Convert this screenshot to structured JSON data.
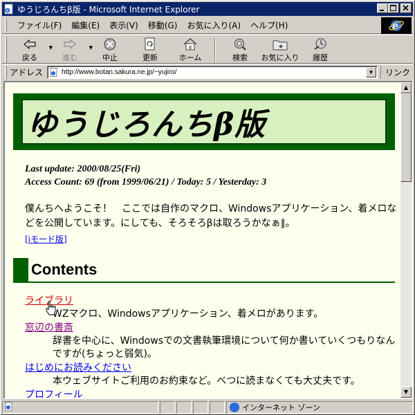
{
  "window": {
    "title": "ゆうじろんちβ版 - Microsoft Internet Explorer",
    "buttons": [
      "minimize",
      "maximize",
      "close"
    ]
  },
  "menu": {
    "items": [
      "ファイル(F)",
      "編集(E)",
      "表示(V)",
      "移動(G)",
      "お気に入り(A)",
      "ヘルプ(H)"
    ]
  },
  "toolbar": {
    "back": "戻る",
    "forward": "進む",
    "stop": "中止",
    "refresh": "更新",
    "home": "ホーム",
    "search": "検索",
    "favorites": "お気に入り",
    "history": "履歴"
  },
  "address": {
    "label": "アドレス",
    "url": "http://www.botan.sakura.ne.jp/~yujiro/",
    "links": "リンク"
  },
  "page": {
    "banner_title": "ゆうじろんちβ版",
    "last_update": "Last update: 2000/08/25(Fri)",
    "access_count": "Access Count: 69 (from 1999/06/21) / Today: 5 / Yesterday: 3",
    "intro": "僕んちへようこそ！　ここでは自作のマクロ、Windowsアプリケーション、着メロなどを公開しています。にしても、そろそろβは取ろうかなぁ∥。",
    "imode_link": "[iモード版]",
    "contents_heading": "Contents",
    "entries": [
      {
        "link": "ライブラリ",
        "desc": "WZマクロ、Windowsアプリケーション、着メロがあります。"
      },
      {
        "link": "窓辺の書斎",
        "desc": "辞書を中心に、Windowsでの文書執筆環境について何か書いていくつもりなんですが(ちょっと弱気)。"
      },
      {
        "link": "はじめにお読みください",
        "desc": "本ウェブサイトご利用のお約束など。べつに読まなくても大丈夫です。"
      },
      {
        "link": "プロフィール",
        "desc": ""
      }
    ]
  },
  "status": {
    "main": "",
    "zone": "インターネット ゾーン"
  },
  "colors": {
    "title_bar": "#0a246a",
    "page_background": "#ffffee",
    "banner_green": "#006000",
    "banner_light": "#d8f0c0"
  }
}
